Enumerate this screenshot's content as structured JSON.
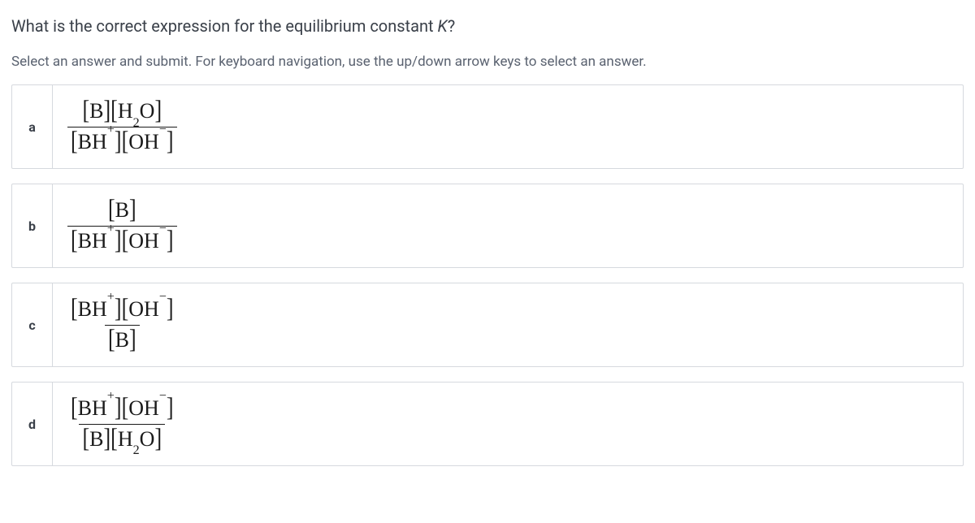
{
  "question": {
    "prefix": "What is the correct expression for the equilibrium constant ",
    "variable": "K",
    "suffix": "?"
  },
  "instructions": "Select an answer and submit. For keyboard navigation, use the up/down arrow keys to select an answer.",
  "options": [
    {
      "key": "a",
      "numerator": "[B][H2O]",
      "denominator": "[BH+][OH-]"
    },
    {
      "key": "b",
      "numerator": "[B]",
      "denominator": "[BH+][OH-]"
    },
    {
      "key": "c",
      "numerator": "[BH+][OH-]",
      "denominator": "[B]"
    },
    {
      "key": "d",
      "numerator": "[BH+][OH-]",
      "denominator": "[B][H2O]"
    }
  ]
}
